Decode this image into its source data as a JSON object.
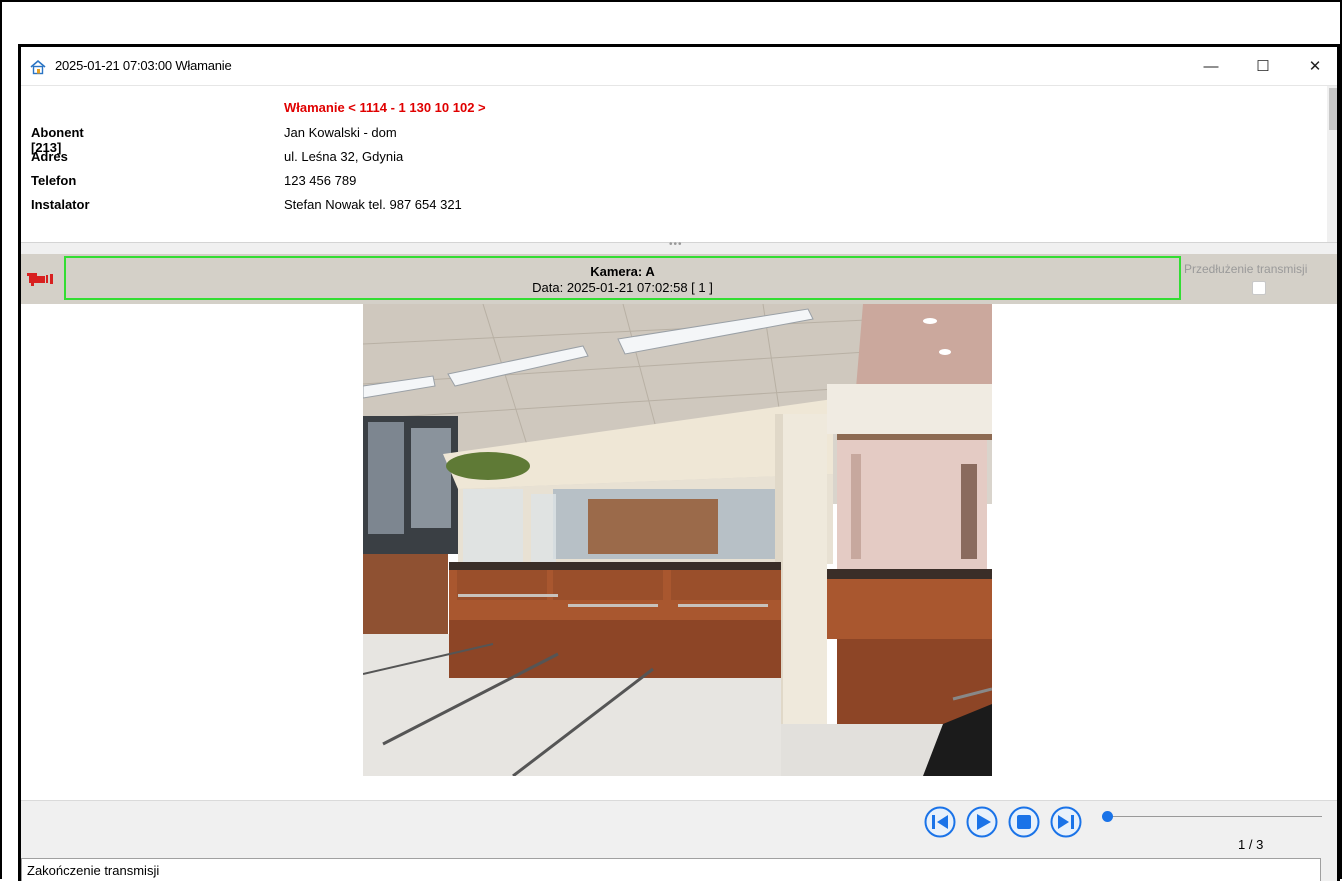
{
  "window": {
    "title": "2025-01-21 07:03:00 Włamanie",
    "minimize_glyph": "—",
    "maximize_glyph": "☐",
    "close_glyph": "✕"
  },
  "alarm": {
    "heading": "Włamanie < 1114 - 1 130 10 102 >",
    "color": "#e00000"
  },
  "subscriber": {
    "rows": [
      {
        "label": "Abonent [213]",
        "value": "Jan Kowalski - dom"
      },
      {
        "label": "Adres",
        "value": "ul. Leśna 32, Gdynia"
      },
      {
        "label": "Telefon",
        "value": "123 456 789"
      },
      {
        "label": "Instalator",
        "value": "Stefan Nowak tel. 987 654 321"
      }
    ]
  },
  "camera": {
    "name": "Kamera: A",
    "date": "Data: 2025-01-21 07:02:58 [ 1 ]",
    "icon": "camera-icon",
    "frame_color": "#33dd33",
    "extend_label": "Przedłużenie transmisji",
    "extend_checked": false
  },
  "player": {
    "buttons": [
      "previous-icon",
      "play-icon",
      "stop-icon",
      "next-icon"
    ],
    "progress": 0,
    "page": "1 / 3",
    "accent": "#1a73e8"
  },
  "status": {
    "text": "Zakończenie transmisji"
  }
}
